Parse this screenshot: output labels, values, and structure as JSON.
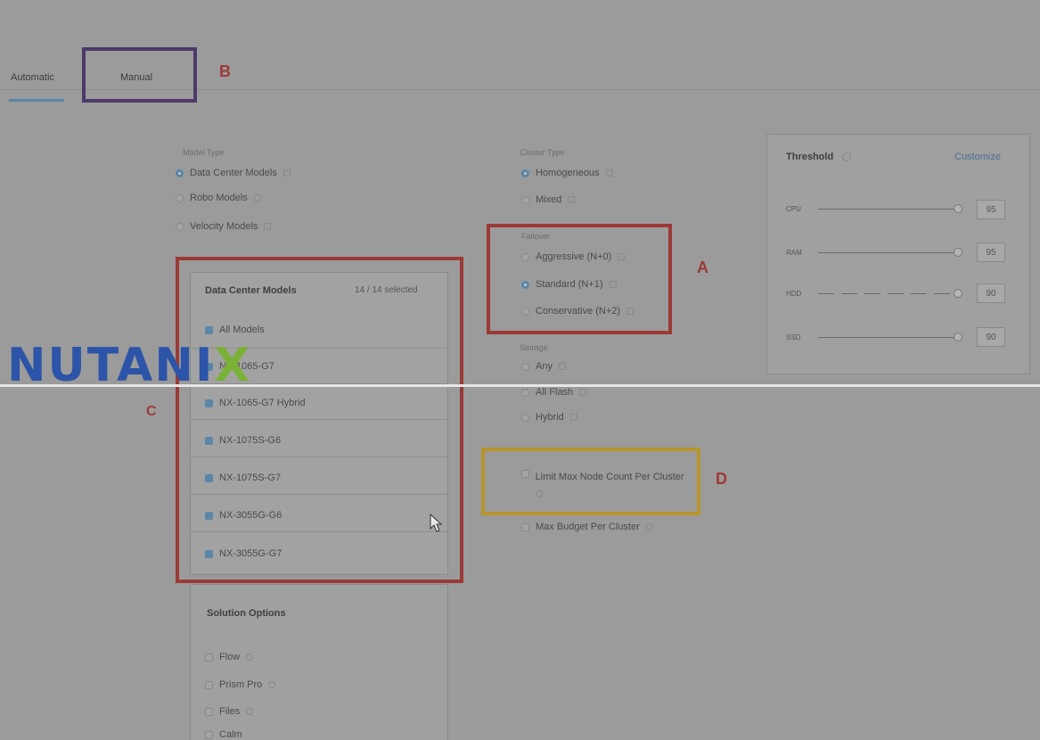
{
  "tabs": {
    "automatic": "Automatic",
    "manual": "Manual"
  },
  "annotations": {
    "a": "A",
    "b": "B",
    "c": "C",
    "d": "D"
  },
  "model_type": {
    "title": "Model Type",
    "options": [
      "Data Center Models",
      "Robo Models",
      "Velocity Models"
    ],
    "selected_index": 0
  },
  "cluster_type": {
    "title": "Cluster Type",
    "options": [
      "Homogeneous",
      "Mixed"
    ],
    "selected_index": 0
  },
  "failover": {
    "title": "Failover",
    "options": [
      "Aggressive (N+0)",
      "Standard (N+1)",
      "Conservative (N+2)"
    ],
    "selected_index": 1
  },
  "storage": {
    "title": "Storage",
    "options": [
      "Any",
      "All Flash",
      "Hybrid"
    ],
    "selected_index": 0
  },
  "limits": {
    "max_node": "Limit Max Node Count Per Cluster",
    "max_budget": "Max Budget Per Cluster"
  },
  "dc_models": {
    "title": "Data Center Models",
    "count": "14 / 14 selected",
    "items": [
      "All Models",
      "NX-1065-G7",
      "NX-1065-G7 Hybrid",
      "NX-1075S-G6",
      "NX-1075S-G7",
      "NX-3055G-G6",
      "NX-3055G-G7"
    ]
  },
  "solution_options": {
    "title": "Solution Options",
    "items": [
      "Flow",
      "Prism Pro",
      "Files",
      "Calm"
    ]
  },
  "threshold": {
    "title": "Threshold",
    "customize": "Customize",
    "rows": [
      {
        "label": "CPU",
        "value": "95"
      },
      {
        "label": "RAM",
        "value": "95"
      },
      {
        "label": "HDD",
        "value": "90"
      },
      {
        "label": "SSD",
        "value": "90"
      }
    ]
  },
  "logo": {
    "left": "NUTANI",
    "x": "X"
  },
  "colors": {
    "accent": "#5a86a8",
    "red_box": "#9b3a36",
    "yellow_box": "#b8942a",
    "purple_box": "#4e3a6a"
  }
}
